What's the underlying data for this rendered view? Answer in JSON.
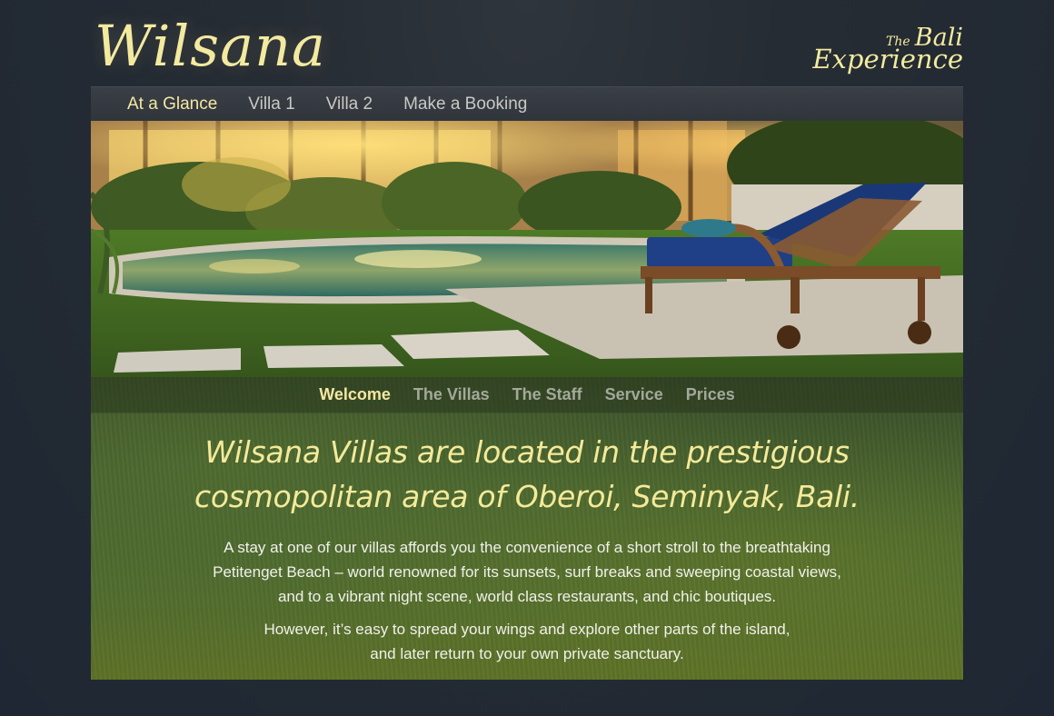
{
  "brand": {
    "logo": "Wilsana",
    "tagline_the": "The",
    "tagline_bali": "Bali",
    "tagline_experience": "Experience"
  },
  "nav": {
    "items": [
      {
        "label": "At a Glance",
        "active": true
      },
      {
        "label": "Villa 1",
        "active": false
      },
      {
        "label": "Villa 2",
        "active": false
      },
      {
        "label": "Make a Booking",
        "active": false
      }
    ]
  },
  "subnav": {
    "items": [
      {
        "label": "Welcome",
        "active": true
      },
      {
        "label": "The Villas",
        "active": false
      },
      {
        "label": "The Staff",
        "active": false
      },
      {
        "label": "Service",
        "active": false
      },
      {
        "label": "Prices",
        "active": false
      }
    ]
  },
  "content": {
    "headline_line1": "Wilsana Villas are located in the prestigious",
    "headline_line2": "cosmopolitan area of Oberoi, Seminyak, Bali.",
    "para1_line1": "A stay at one of our villas affords you the convenience of a short stroll to the breathtaking",
    "para1_line2": "Petitenget Beach – world renowned for its sunsets, surf breaks and sweeping coastal views,",
    "para1_line3": "and to a vibrant night scene, world class restaurants, and chic boutiques.",
    "para2_line1": "However, it’s easy to spread your wings and explore other parts of the island,",
    "para2_line2": "and later return to your own private sanctuary."
  },
  "colors": {
    "accent": "#f4e7a3",
    "background": "#1e2733",
    "nav_bg": "#353a41"
  }
}
